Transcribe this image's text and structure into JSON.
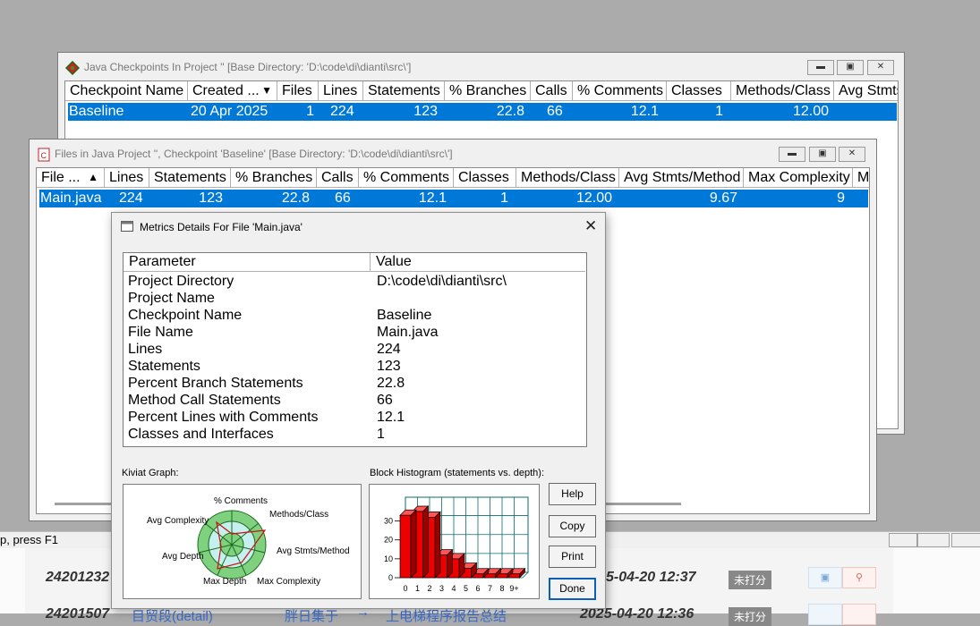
{
  "checkpoints_window": {
    "title": "Java Checkpoints In Project ''  [Base Directory: 'D:\\code\\di\\dianti\\src\\']",
    "columns": [
      "Checkpoint Name",
      "Created ...",
      "Files",
      "Lines",
      "Statements",
      "% Branches",
      "Calls",
      "% Comments",
      "Classes",
      "Methods/Class",
      "Avg Stmts"
    ],
    "row": {
      "name": "Baseline",
      "created": "20 Apr 2025",
      "files": "1",
      "lines": "224",
      "statements": "123",
      "branches": "22.8",
      "calls": "66",
      "comments": "12.1",
      "classes": "1",
      "methods_per_class": "12.00"
    }
  },
  "files_window": {
    "title": "Files in Java Project '', Checkpoint 'Baseline'  [Base Directory: 'D:\\code\\di\\dianti\\src\\']",
    "columns": [
      "File ...",
      "Lines",
      "Statements",
      "% Branches",
      "Calls",
      "% Comments",
      "Classes",
      "Methods/Class",
      "Avg Stmts/Method",
      "Max Complexity",
      "M"
    ],
    "row": {
      "file": "Main.java",
      "lines": "224",
      "statements": "123",
      "branches": "22.8",
      "calls": "66",
      "comments": "12.1",
      "classes": "1",
      "methods_per_class": "12.00",
      "avg_stmts": "9.67",
      "max_complexity": "9"
    }
  },
  "dialog": {
    "title": "Metrics Details For File 'Main.java'",
    "columns": [
      "Parameter",
      "Value"
    ],
    "params": [
      {
        "name": "Project Directory",
        "value": "D:\\code\\di\\dianti\\src\\"
      },
      {
        "name": "Project Name",
        "value": ""
      },
      {
        "name": "Checkpoint Name",
        "value": "Baseline"
      },
      {
        "name": "File Name",
        "value": "Main.java"
      },
      {
        "name": "Lines",
        "value": "224"
      },
      {
        "name": "Statements",
        "value": "123"
      },
      {
        "name": "Percent Branch Statements",
        "value": "22.8"
      },
      {
        "name": "Method Call Statements",
        "value": "66"
      },
      {
        "name": "Percent Lines with Comments",
        "value": "12.1"
      },
      {
        "name": "Classes and Interfaces",
        "value": "1"
      }
    ],
    "kiviat_label": "Kiviat Graph:",
    "kiviat_axes": [
      "% Comments",
      "Methods/Class",
      "Avg Stmts/Method",
      "Max Complexity",
      "Max Depth",
      "Avg Depth",
      "Avg Complexity"
    ],
    "histogram_label": "Block Histogram (statements vs. depth):",
    "buttons": {
      "help": "Help",
      "copy": "Copy",
      "print": "Print",
      "done": "Done"
    }
  },
  "chart_data": {
    "type": "bar",
    "title": "Block Histogram (statements vs. depth):",
    "categories": [
      "0",
      "1",
      "2",
      "3",
      "4",
      "5",
      "6",
      "7",
      "8",
      "9+"
    ],
    "values": [
      33,
      35,
      32,
      12,
      10,
      5,
      2,
      2,
      2,
      2
    ],
    "ylim": [
      0,
      35
    ],
    "yticks": [
      "0",
      "10",
      "20",
      "30"
    ],
    "bar_color": "#ee0000"
  },
  "status_bar": {
    "text": "p, press F1"
  },
  "background_rows": [
    {
      "id": "24201232",
      "date": "5-04-20 12:37",
      "badge": "未打分"
    },
    {
      "id": "24201507",
      "link": "目贸段(detail)",
      "mid1": "胖日集于",
      "mid2": "上电梯程序报告总结",
      "date": "2025-04-20 12:36",
      "badge": "未打分"
    }
  ]
}
